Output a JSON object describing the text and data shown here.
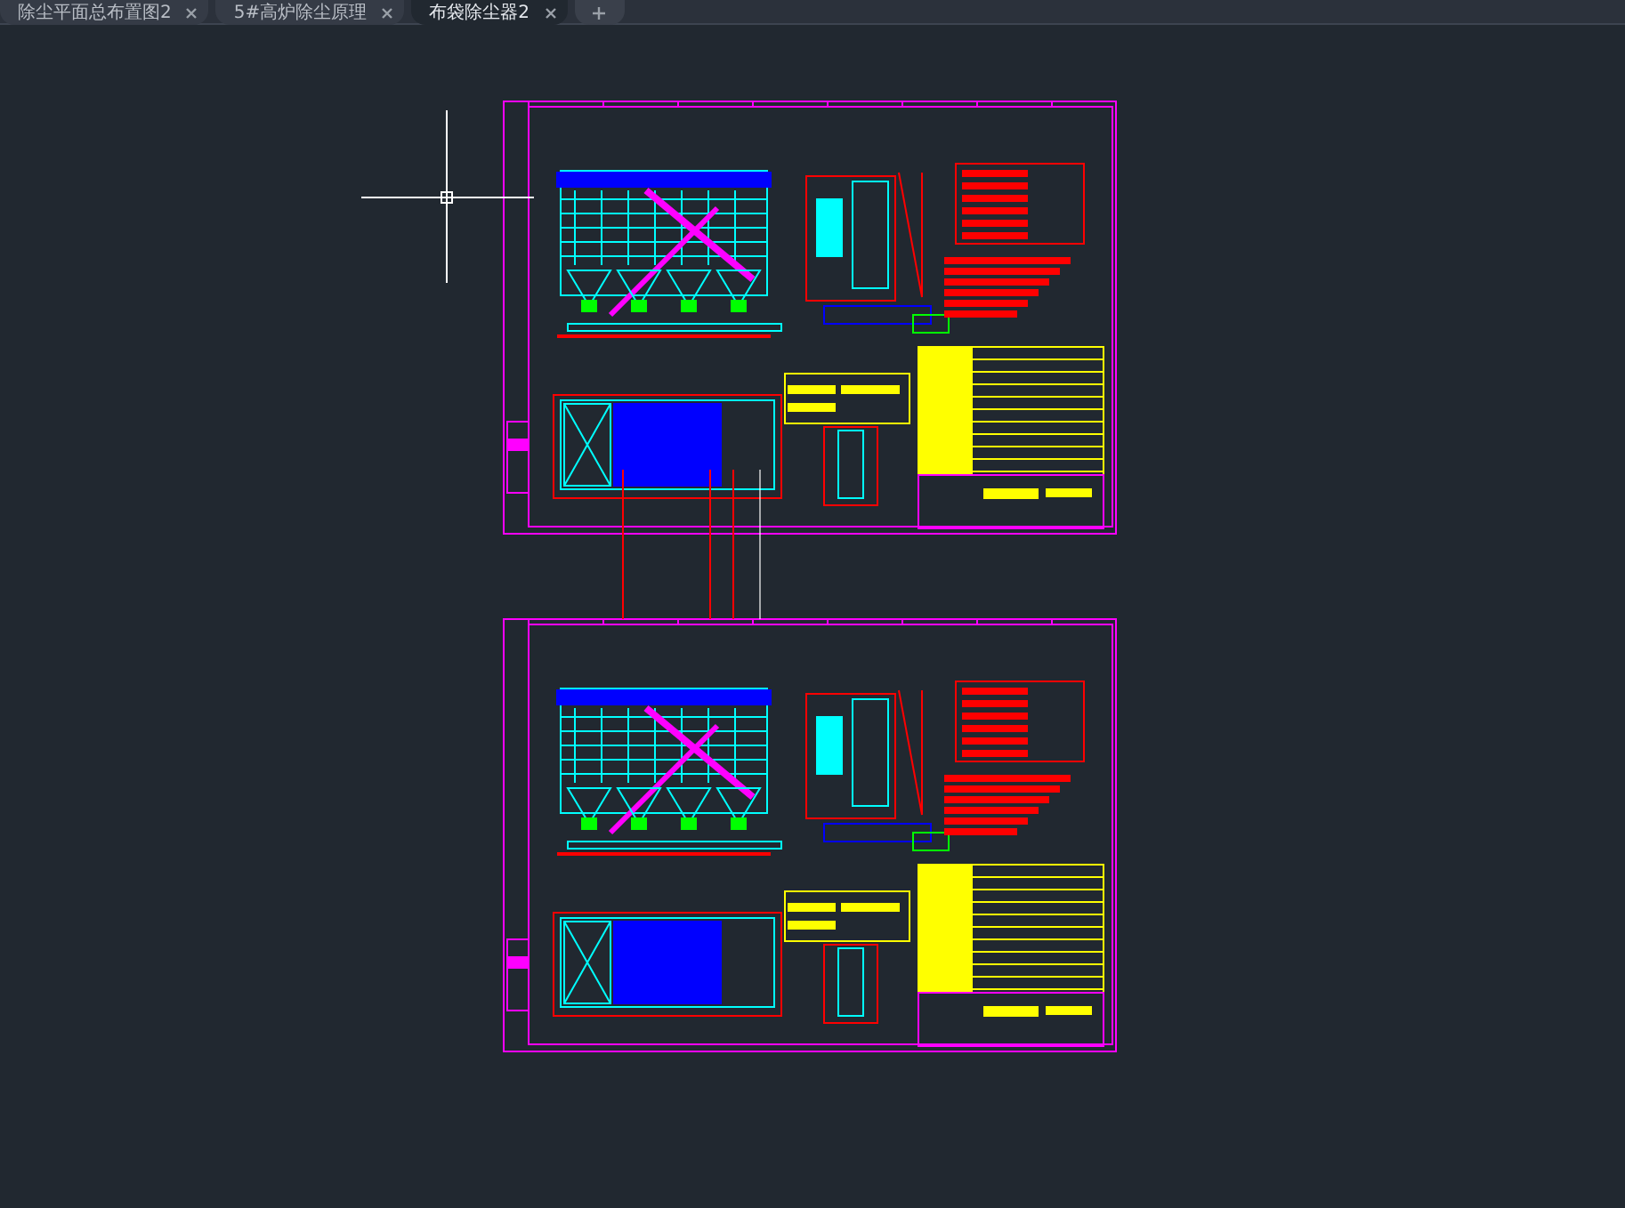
{
  "tabs": [
    {
      "label": "除尘平面总布置图2",
      "selected": false
    },
    {
      "label": "5#高炉除尘原理",
      "selected": false
    },
    {
      "label": "布袋除尘器2",
      "selected": true
    }
  ]
}
